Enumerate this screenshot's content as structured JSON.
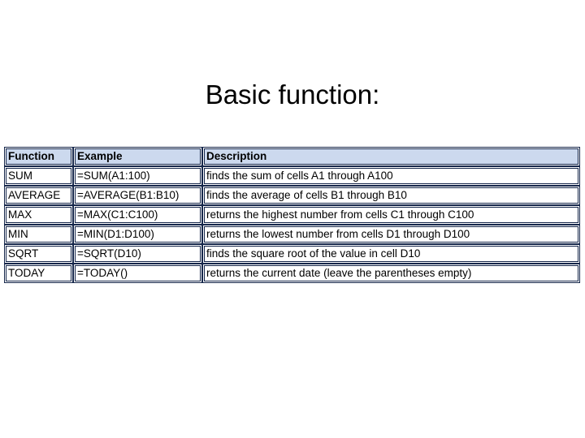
{
  "slide": {
    "title": "Basic function:",
    "background_color": "#ffffff"
  },
  "table": {
    "header_background": "#ccd9ee",
    "border_color": "#15264a",
    "columns": [
      {
        "key": "function",
        "label": "Function"
      },
      {
        "key": "example",
        "label": "Example"
      },
      {
        "key": "description",
        "label": "Description"
      }
    ],
    "rows": [
      {
        "function": "SUM",
        "example": "=SUM(A1:100)",
        "description": "finds the sum of cells A1 through A100"
      },
      {
        "function": "AVERAGE",
        "example": "=AVERAGE(B1:B10)",
        "description": "finds the average of cells B1 through B10"
      },
      {
        "function": "MAX",
        "example": "=MAX(C1:C100)",
        "description": "returns the highest number from cells C1 through C100"
      },
      {
        "function": "MIN",
        "example": "=MIN(D1:D100)",
        "description": "returns the lowest number from cells D1 through D100"
      },
      {
        "function": "SQRT",
        "example": "=SQRT(D10)",
        "description": "finds the square root of the value in cell D10"
      },
      {
        "function": "TODAY",
        "example": "=TODAY()",
        "description": "returns the current date (leave the parentheses empty)"
      }
    ]
  }
}
